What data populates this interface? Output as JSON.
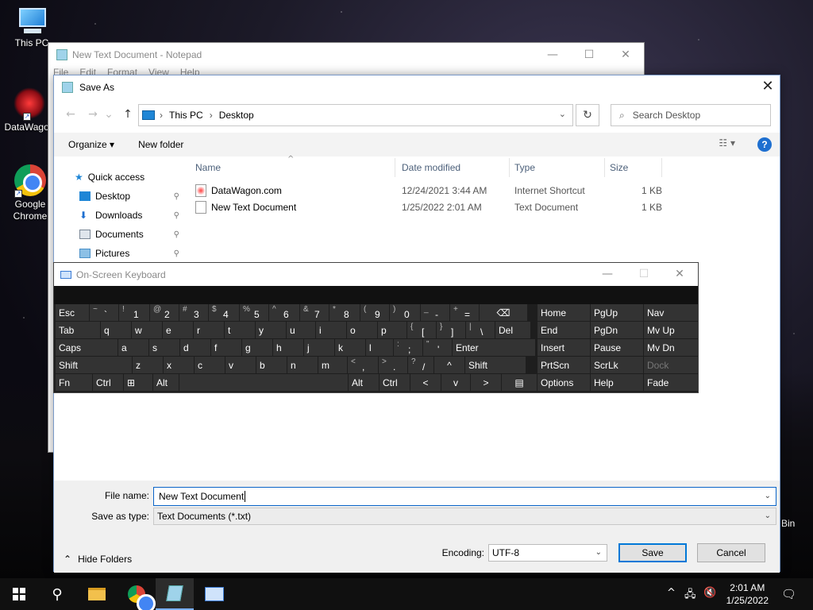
{
  "desktop": {
    "icons": [
      {
        "label": "This PC"
      },
      {
        "label": "DataWagon"
      },
      {
        "label": "Google Chrome"
      }
    ],
    "recycle_label": "Bin"
  },
  "notepad": {
    "title": "New Text Document - Notepad",
    "menu": [
      "File",
      "Edit",
      "Format",
      "View",
      "Help"
    ],
    "controls": {
      "minimize": "—",
      "maximize": "☐",
      "close": "✕"
    }
  },
  "save_dialog": {
    "title": "Save As",
    "close": "✕",
    "nav": {
      "back": "←",
      "forward": "→",
      "recent": "⌄",
      "up": "↑"
    },
    "address": {
      "root": "This PC",
      "separator": "›",
      "folder": "Desktop",
      "dropdown": "⌄"
    },
    "refresh": "↻",
    "search_placeholder": "Search Desktop",
    "search_icon": "⌕",
    "toolbar": {
      "organize": "Organize ▾",
      "new_folder": "New folder",
      "view": "☷ ▾",
      "help": "?"
    },
    "nav_pane": {
      "quick_access": "Quick access",
      "items": [
        {
          "label": "Desktop",
          "color": "#1f86d6"
        },
        {
          "label": "Downloads",
          "color": "#1f6fd0"
        },
        {
          "label": "Documents",
          "color": "#7a8796"
        },
        {
          "label": "Pictures",
          "color": "#4a90c8"
        }
      ],
      "pin": "📌"
    },
    "columns": {
      "name": "Name",
      "date": "Date modified",
      "type": "Type",
      "size": "Size"
    },
    "sort_indicator": "^",
    "files": [
      {
        "name": "DataWagon.com",
        "date": "12/24/2021 3:44 AM",
        "type": "Internet Shortcut",
        "size": "1 KB",
        "icon": "web-shortcut-icon"
      },
      {
        "name": "New Text Document",
        "date": "1/25/2022 2:01 AM",
        "type": "Text Document",
        "size": "1 KB",
        "icon": "text-file-icon"
      }
    ],
    "file_name_label": "File name:",
    "file_name_value": "New Text Document",
    "save_type_label": "Save as type:",
    "save_type_value": "Text Documents (*.txt)",
    "hide_folders": "Hide Folders",
    "encoding_label": "Encoding:",
    "encoding_value": "UTF-8",
    "save_button": "Save",
    "cancel_button": "Cancel"
  },
  "osk": {
    "title": "On-Screen Keyboard",
    "controls": {
      "minimize": "—",
      "maximize": "☐",
      "close": "✕"
    },
    "rows": [
      [
        {
          "t": "Esc",
          "w": 42
        },
        {
          "u": "~",
          "l": "`",
          "w": 36
        },
        {
          "u": "!",
          "l": "1",
          "w": 38
        },
        {
          "u": "@",
          "l": "2",
          "w": 36
        },
        {
          "u": "#",
          "l": "3",
          "w": 36
        },
        {
          "u": "$",
          "l": "4",
          "w": 38
        },
        {
          "u": "%",
          "l": "5",
          "w": 36
        },
        {
          "u": "^",
          "l": "6",
          "w": 38
        },
        {
          "u": "&",
          "l": "7",
          "w": 36
        },
        {
          "u": "*",
          "l": "8",
          "w": 38
        },
        {
          "u": "(",
          "l": "9",
          "w": 36
        },
        {
          "u": ")",
          "l": "0",
          "w": 38
        },
        {
          "u": "_",
          "l": "-",
          "w": 36
        },
        {
          "u": "+",
          "l": "=",
          "w": 36
        },
        {
          "t": "⌫",
          "w": 60,
          "c": true
        }
      ],
      [
        {
          "t": "Tab",
          "w": 56
        },
        {
          "t": "q",
          "w": 38
        },
        {
          "t": "w",
          "w": 38
        },
        {
          "t": "e",
          "w": 38
        },
        {
          "t": "r",
          "w": 38
        },
        {
          "t": "t",
          "w": 38
        },
        {
          "t": "y",
          "w": 38
        },
        {
          "t": "u",
          "w": 36
        },
        {
          "t": "i",
          "w": 38
        },
        {
          "t": "o",
          "w": 38
        },
        {
          "t": "p",
          "w": 36
        },
        {
          "u": "{",
          "l": "[",
          "w": 36
        },
        {
          "u": "}",
          "l": "]",
          "w": 36
        },
        {
          "u": "|",
          "l": "\\",
          "w": 36
        },
        {
          "t": "Del",
          "w": 44
        }
      ],
      [
        {
          "t": "Caps",
          "w": 78
        },
        {
          "t": "a",
          "w": 38
        },
        {
          "t": "s",
          "w": 38
        },
        {
          "t": "d",
          "w": 38
        },
        {
          "t": "f",
          "w": 38
        },
        {
          "t": "g",
          "w": 38
        },
        {
          "t": "h",
          "w": 38
        },
        {
          "t": "j",
          "w": 38
        },
        {
          "t": "k",
          "w": 38
        },
        {
          "t": "l",
          "w": 34
        },
        {
          "u": ":",
          "l": ";",
          "w": 36
        },
        {
          "u": "\"",
          "l": "'",
          "w": 36
        },
        {
          "t": "Enter",
          "w": 104
        }
      ],
      [
        {
          "t": "Shift",
          "w": 96
        },
        {
          "t": "z",
          "w": 38
        },
        {
          "t": "x",
          "w": 38
        },
        {
          "t": "c",
          "w": 38
        },
        {
          "t": "v",
          "w": 38
        },
        {
          "t": "b",
          "w": 38
        },
        {
          "t": "n",
          "w": 38
        },
        {
          "t": "m",
          "w": 36
        },
        {
          "u": "<",
          "l": ",",
          "w": 38
        },
        {
          "u": ">",
          "l": ".",
          "w": 36
        },
        {
          "u": "?",
          "l": "/",
          "w": 32
        },
        {
          "t": "^",
          "w": 38,
          "c": true
        },
        {
          "t": "Shift",
          "w": 76
        }
      ],
      [
        {
          "t": "Fn",
          "w": 46
        },
        {
          "t": "Ctrl",
          "w": 38
        },
        {
          "t": "⊞",
          "w": 36
        },
        {
          "t": "Alt",
          "w": 32
        },
        {
          "t": "",
          "w": 212
        },
        {
          "t": "Alt",
          "w": 38
        },
        {
          "t": "Ctrl",
          "w": 38
        },
        {
          "t": "<",
          "w": 38,
          "c": true
        },
        {
          "t": "v",
          "w": 36,
          "c": true
        },
        {
          "t": ">",
          "w": 38,
          "c": true
        },
        {
          "t": "▤",
          "w": 44,
          "c": true
        }
      ]
    ],
    "side": [
      [
        {
          "t": "Home"
        },
        {
          "t": "PgUp"
        },
        {
          "t": "Nav"
        }
      ],
      [
        {
          "t": "End"
        },
        {
          "t": "PgDn"
        },
        {
          "t": "Mv Up"
        }
      ],
      [
        {
          "t": "Insert"
        },
        {
          "t": "Pause"
        },
        {
          "t": "Mv Dn"
        }
      ],
      [
        {
          "t": "PrtScn"
        },
        {
          "t": "ScrLk"
        },
        {
          "t": "Dock",
          "dim": true
        }
      ],
      [
        {
          "t": "Options"
        },
        {
          "t": "Help"
        },
        {
          "t": "Fade"
        }
      ]
    ]
  },
  "taskbar": {
    "time": "2:01 AM",
    "date": "1/25/2022",
    "search_icon": "⚲",
    "tray": {
      "chevron": "^",
      "network": "🖧",
      "volume": "🔇",
      "notification": "🗨"
    }
  }
}
